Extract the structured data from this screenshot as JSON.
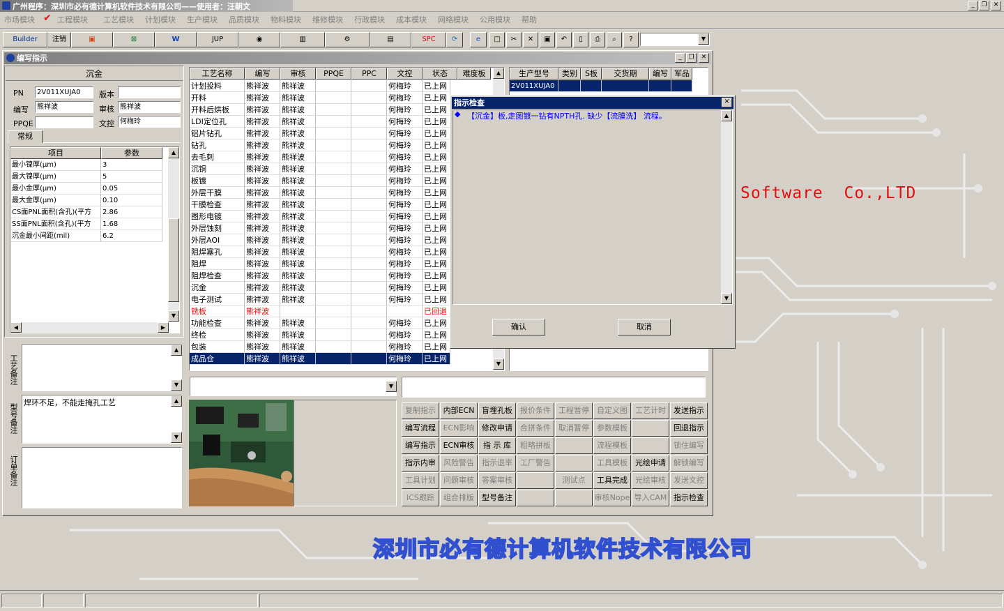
{
  "app_title": "广州程序：深圳市必有德计算机软件技术有限公司——使用者：汪朝文",
  "menu": [
    "市场模块",
    "工程模块",
    "工艺模块",
    "计划模块",
    "生产模块",
    "品质模块",
    "物料模块",
    "维修模块",
    "行政模块",
    "成本模块",
    "网络模块",
    "公用模块",
    "帮助"
  ],
  "toolbar": {
    "builder": "Builder",
    "logout": "注销",
    "jup": "JUP",
    "spc": "SPC"
  },
  "window_title": "编写指示",
  "left": {
    "section_title": "沉金",
    "pn_label": "PN",
    "pn_value": "2V011XUJA0",
    "version_label": "版本",
    "version_value": "",
    "writer_label": "编写",
    "writer_value": "熊祥波",
    "reviewer_label": "审核",
    "reviewer_value": "熊祥波",
    "ppqe_label": "PPQE",
    "ppqe_value": "",
    "doc_label": "文控",
    "doc_value": "何梅玲",
    "tab": "常规",
    "param_headers": [
      "项目",
      "参数"
    ],
    "params": [
      [
        "最小镍厚(μm)",
        "3"
      ],
      [
        "最大镍厚(μm)",
        "5"
      ],
      [
        "最小金厚(μm)",
        "0.05"
      ],
      [
        "最大金厚(μm)",
        "0.10"
      ],
      [
        "CS面PNL面积(含孔)(平方",
        "2.86"
      ],
      [
        "SS面PNL面积(含孔)(平方",
        "1.68"
      ],
      [
        "沉金最小间距(mil)",
        "6.2"
      ]
    ],
    "process_note_label": "工艺备注",
    "model_note_label": "型号备注",
    "model_note_value": "焊环不足，不能走掩孔工艺",
    "order_note_label": "订单备注"
  },
  "process_grid": {
    "headers": [
      "工艺名称",
      "编写",
      "审核",
      "PPQE",
      "PPC",
      "文控",
      "状态",
      "难度板"
    ],
    "rows": [
      [
        "计划投料",
        "熊祥波",
        "熊祥波",
        "",
        "",
        "何梅玲",
        "已上网"
      ],
      [
        "开料",
        "熊祥波",
        "熊祥波",
        "",
        "",
        "何梅玲",
        "已上网"
      ],
      [
        "开料后烘板",
        "熊祥波",
        "熊祥波",
        "",
        "",
        "何梅玲",
        "已上网"
      ],
      [
        "LDI定位孔",
        "熊祥波",
        "熊祥波",
        "",
        "",
        "何梅玲",
        "已上网"
      ],
      [
        "铝片钻孔",
        "熊祥波",
        "熊祥波",
        "",
        "",
        "何梅玲",
        "已上网"
      ],
      [
        "钻孔",
        "熊祥波",
        "熊祥波",
        "",
        "",
        "何梅玲",
        "已上网"
      ],
      [
        "去毛刺",
        "熊祥波",
        "熊祥波",
        "",
        "",
        "何梅玲",
        "已上网"
      ],
      [
        "沉铜",
        "熊祥波",
        "熊祥波",
        "",
        "",
        "何梅玲",
        "已上网"
      ],
      [
        "板镀",
        "熊祥波",
        "熊祥波",
        "",
        "",
        "何梅玲",
        "已上网"
      ],
      [
        "外层干膜",
        "熊祥波",
        "熊祥波",
        "",
        "",
        "何梅玲",
        "已上网"
      ],
      [
        "干膜检查",
        "熊祥波",
        "熊祥波",
        "",
        "",
        "何梅玲",
        "已上网"
      ],
      [
        "图形电镀",
        "熊祥波",
        "熊祥波",
        "",
        "",
        "何梅玲",
        "已上网"
      ],
      [
        "外层蚀刻",
        "熊祥波",
        "熊祥波",
        "",
        "",
        "何梅玲",
        "已上网"
      ],
      [
        "外层AOI",
        "熊祥波",
        "熊祥波",
        "",
        "",
        "何梅玲",
        "已上网"
      ],
      [
        "阻焊塞孔",
        "熊祥波",
        "熊祥波",
        "",
        "",
        "何梅玲",
        "已上网"
      ],
      [
        "阻焊",
        "熊祥波",
        "熊祥波",
        "",
        "",
        "何梅玲",
        "已上网"
      ],
      [
        "阻焊检查",
        "熊祥波",
        "熊祥波",
        "",
        "",
        "何梅玲",
        "已上网"
      ],
      [
        "沉金",
        "熊祥波",
        "熊祥波",
        "",
        "",
        "何梅玲",
        "已上网"
      ],
      [
        "电子测试",
        "熊祥波",
        "熊祥波",
        "",
        "",
        "何梅玲",
        "已上网"
      ],
      [
        "铣板",
        "熊祥波",
        "",
        "",
        "",
        "",
        "已回退"
      ],
      [
        "功能检查",
        "熊祥波",
        "熊祥波",
        "",
        "",
        "何梅玲",
        "已上网"
      ],
      [
        "终检",
        "熊祥波",
        "熊祥波",
        "",
        "",
        "何梅玲",
        "已上网"
      ],
      [
        "包装",
        "熊祥波",
        "熊祥波",
        "",
        "",
        "何梅玲",
        "已上网"
      ],
      [
        "成品仓",
        "熊祥波",
        "熊祥波",
        "",
        "",
        "何梅玲",
        "已上网"
      ]
    ]
  },
  "model_grid": {
    "headers": [
      "生产型号",
      "类别",
      "S板",
      "交货期",
      "编写",
      "军品"
    ],
    "row": [
      "2V011XUJA0",
      "",
      "",
      "",
      "",
      ""
    ]
  },
  "dialog": {
    "title": "指示检查",
    "message": "【沉金】板,走图镀一钻有NPTH孔. 缺少【流膜洗】 流程。",
    "ok": "确认",
    "cancel": "取消"
  },
  "buttons": [
    [
      "复制指示",
      "内部ECN",
      "盲埋孔板",
      "报价条件",
      "工程暂停",
      "自定义图",
      "工艺计时",
      "发送指示"
    ],
    [
      "编写流程",
      "ECN影响",
      "修改申请",
      "合拼条件",
      "取消暂停",
      "参数模板",
      "",
      "回退指示"
    ],
    [
      "编写指示",
      "ECN审核",
      "指 示 库",
      "粗略拼板",
      "",
      "流程模板",
      "",
      "锁住编写"
    ],
    [
      "指示内审",
      "风险警告",
      "指示退率",
      "工厂警告",
      "",
      "工具模板",
      "光绘申请",
      "解锁编写"
    ],
    [
      "工具计划",
      "问题审核",
      "答案审核",
      "",
      "测试点",
      "工具完成",
      "光绘审核",
      "发送文控"
    ],
    [
      "ICS跟踪",
      "组合排版",
      "型号备注",
      "",
      "",
      "审核Nope",
      "导入CAM",
      "指示检查"
    ]
  ],
  "buttons_disabled": [
    [
      true,
      false,
      false,
      true,
      true,
      true,
      true,
      false
    ],
    [
      false,
      true,
      false,
      true,
      true,
      true,
      true,
      false
    ],
    [
      false,
      false,
      false,
      true,
      true,
      true,
      true,
      true
    ],
    [
      false,
      true,
      true,
      true,
      true,
      true,
      false,
      true
    ],
    [
      true,
      true,
      true,
      true,
      true,
      false,
      true,
      true
    ],
    [
      true,
      true,
      false,
      true,
      true,
      true,
      true,
      false
    ]
  ],
  "background": {
    "software_text": "Software  Co.,LTD",
    "company_text": "深圳市必有德计算机软件技术有限公司"
  },
  "colors": {
    "selection": "#08246b",
    "warning_red": "#ff0000",
    "brand_red": "#e01010",
    "brand_blue": "#3050d0"
  }
}
